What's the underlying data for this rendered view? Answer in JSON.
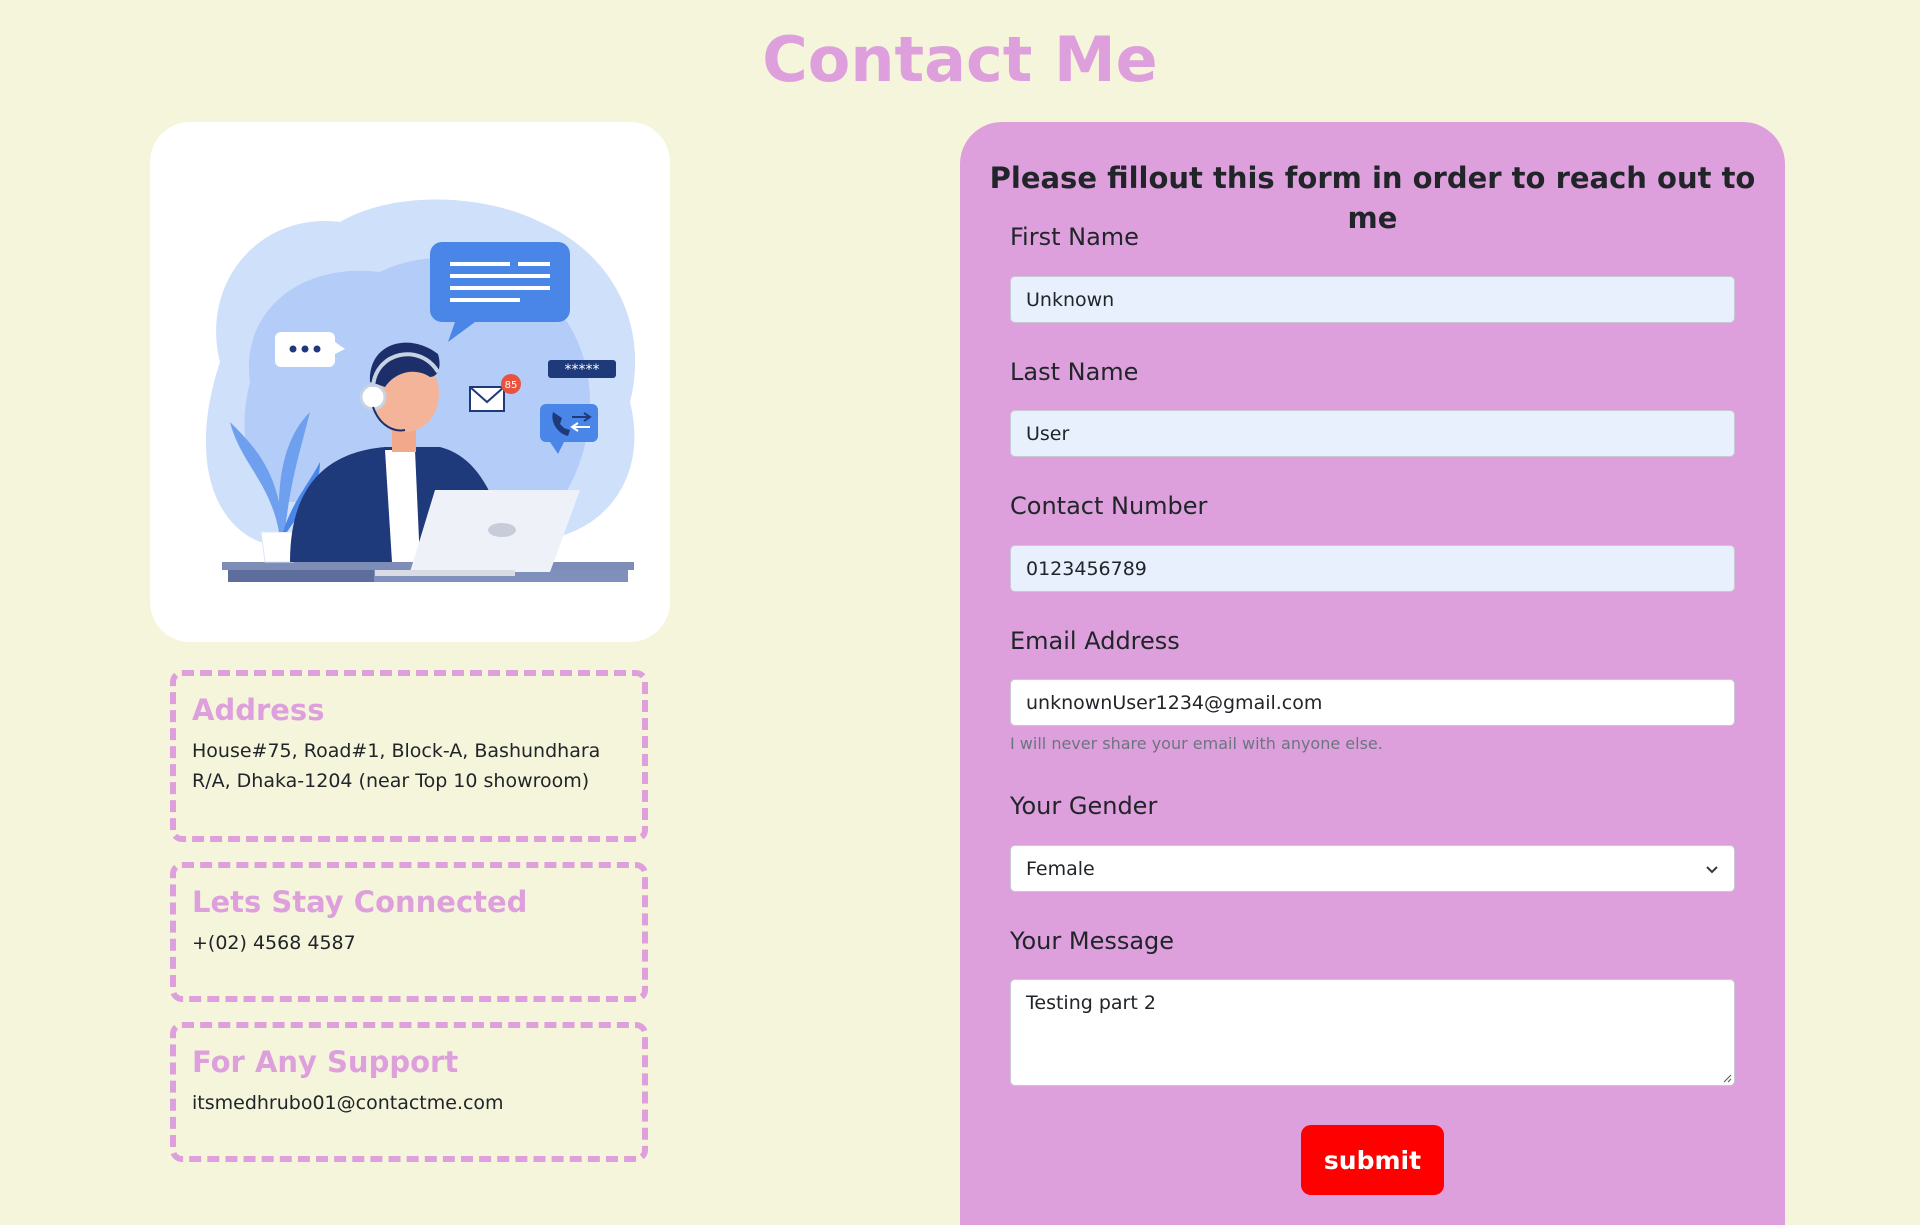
{
  "page": {
    "title": "Contact Me"
  },
  "info": {
    "address": {
      "heading": "Address",
      "text": "House#75, Road#1, Block-A, Bashundhara R/A, Dhaka-1204 (near Top 10 showroom)"
    },
    "phone": {
      "heading": "Lets Stay Connected",
      "text": "+(02) 4568 4587"
    },
    "support": {
      "heading": "For Any Support",
      "text": "itsmedhrubo01@contactme.com"
    }
  },
  "illustration": {
    "badge_count": "85",
    "password_mask": "*****"
  },
  "form": {
    "heading": "Please fillout this form in order to reach out to me",
    "first_name": {
      "label": "First Name",
      "value": "Unknown"
    },
    "last_name": {
      "label": "Last Name",
      "value": "User"
    },
    "contact_number": {
      "label": "Contact Number",
      "value": "0123456789"
    },
    "email": {
      "label": "Email Address",
      "value": "unknownUser1234@gmail.com",
      "help": "I will never share your email with anyone else."
    },
    "gender": {
      "label": "Your Gender",
      "value": "Female"
    },
    "message": {
      "label": "Your Message",
      "value": "Testing part 2"
    },
    "submit_label": "submit"
  },
  "colors": {
    "background": "#f5f5dc",
    "accent": "#dda0dd",
    "submit": "#ff0000",
    "autofill": "#e8f0fe"
  },
  "icons": [
    "chevron-down-icon",
    "resize-grip-icon",
    "mail-icon",
    "phone-icon",
    "chat-bubble-icon"
  ]
}
